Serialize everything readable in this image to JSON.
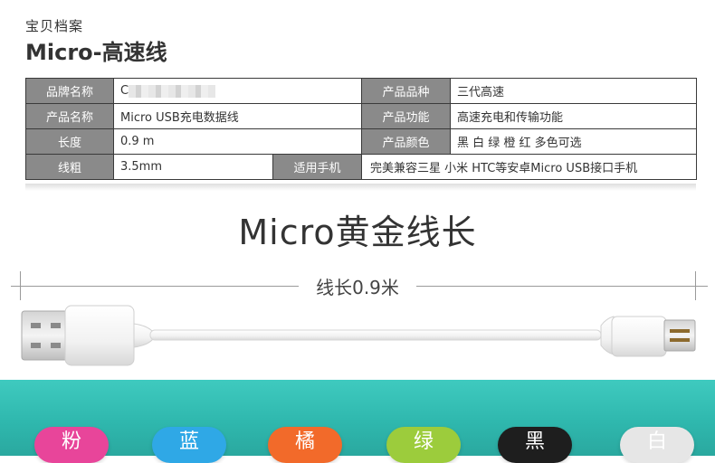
{
  "header": {
    "kicker": "宝贝档案",
    "title": "Micro-高速线"
  },
  "spec": {
    "brand_label": "品牌名称",
    "brand_value": "C",
    "variety_label": "产品品种",
    "variety_value": "三代高速",
    "name_label": "产品名称",
    "name_value": "Micro USB充电数据线",
    "function_label": "产品功能",
    "function_value": "高速充电和传输功能",
    "length_label": "长度",
    "length_value": "0.9 m",
    "color_label": "产品颜色",
    "color_value": "黑 白 绿 橙 红 多色可选",
    "thickness_label": "线粗",
    "thickness_value": "3.5mm",
    "phone_label": "适用手机",
    "phone_value": "完美兼容三星 小米  HTC等安卓Micro USB接口手机"
  },
  "headline": "Micro黄金线长",
  "dimension_label": "线长0.9米",
  "colors": [
    {
      "label": "粉",
      "color": "#e8459a"
    },
    {
      "label": "蓝",
      "color": "#2fa8e6"
    },
    {
      "label": "橘",
      "color": "#f26a2a"
    },
    {
      "label": "绿",
      "color": "#9ccc3c"
    },
    {
      "label": "黑",
      "color": "#1e1e1e"
    },
    {
      "label": "白",
      "color": "#e6e6e6"
    }
  ],
  "accent": "#2fb8ae",
  "label_bg": "#8a8a8a"
}
